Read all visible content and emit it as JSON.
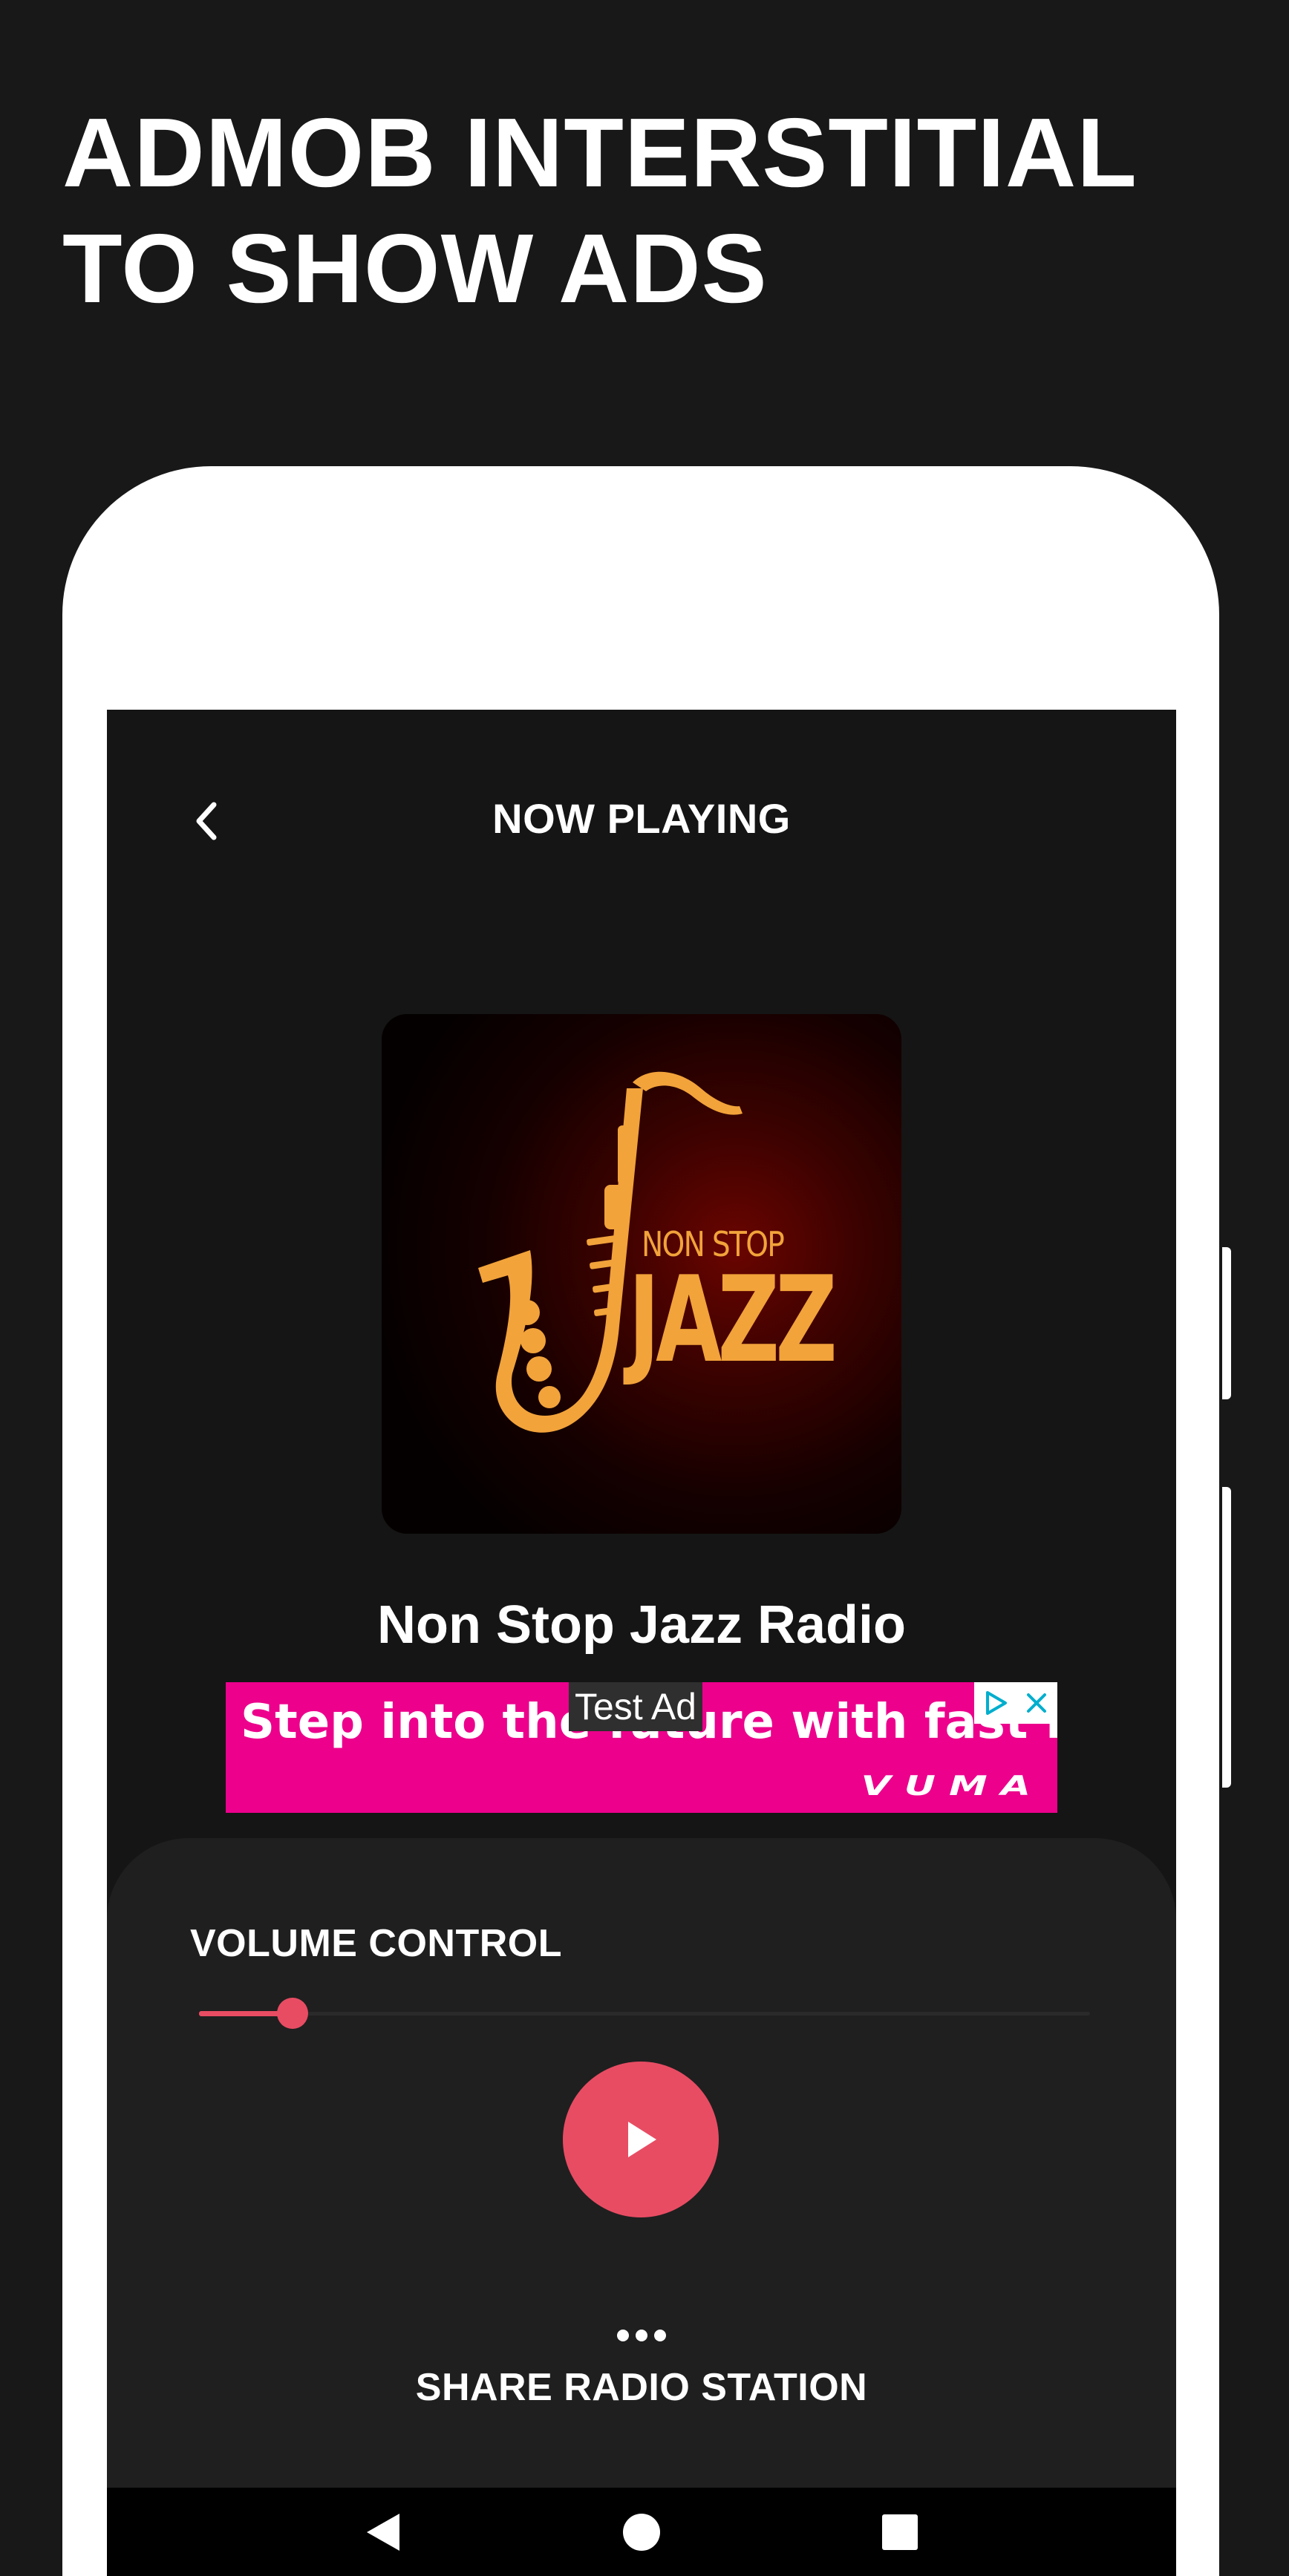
{
  "headline": {
    "line1": "ADMOB INTERSTITIAL",
    "line2": "TO SHOW ADS"
  },
  "screen": {
    "title": "NOW PLAYING",
    "back_icon": "chevron-left-icon"
  },
  "cover": {
    "text_small": "NON STOP",
    "text_big": "JAZZ",
    "accent_color": "#F2A33A"
  },
  "station": {
    "name": "Non Stop Jazz Radio"
  },
  "ad": {
    "label": "Test Ad",
    "headline": "Step into the future with fast fibre",
    "brand": "VUMA",
    "background_color": "#EC008C",
    "icons": [
      "adchoices-icon",
      "close-icon"
    ]
  },
  "player": {
    "volume_label": "VOLUME CONTROL",
    "volume_level": 0.105,
    "accent_color": "#E84C63",
    "play_icon": "play-icon",
    "share_icon": "more-horizontal-icon",
    "share_label": "SHARE RADIO STATION"
  },
  "system_nav": {
    "icons": [
      "nav-back-icon",
      "nav-home-icon",
      "nav-recents-icon"
    ]
  }
}
